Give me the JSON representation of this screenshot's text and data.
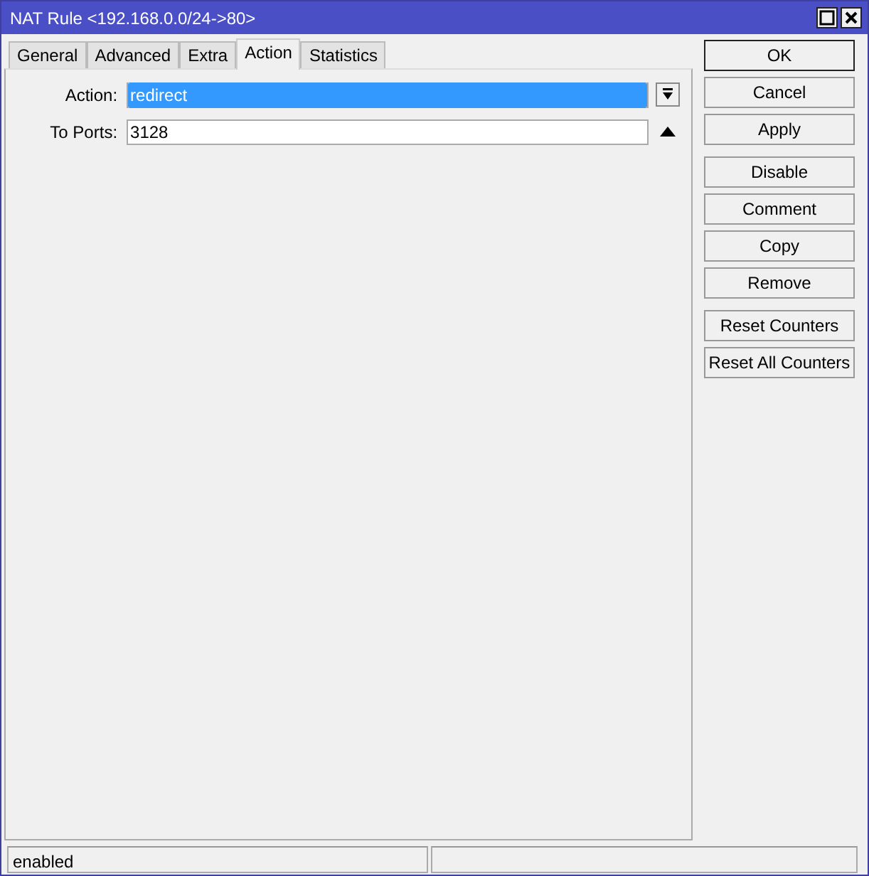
{
  "window": {
    "title": "NAT Rule <192.168.0.0/24->80>"
  },
  "tabs": [
    {
      "label": "General",
      "selected": false
    },
    {
      "label": "Advanced",
      "selected": false
    },
    {
      "label": "Extra",
      "selected": false
    },
    {
      "label": "Action",
      "selected": true
    },
    {
      "label": "Statistics",
      "selected": false
    }
  ],
  "fields": [
    {
      "label": "Action:",
      "value": "redirect",
      "kind": "dropdown",
      "highlighted": true
    },
    {
      "label": "To Ports:",
      "value": "3128",
      "kind": "spin",
      "highlighted": false
    }
  ],
  "button_groups": [
    [
      {
        "label": "OK",
        "default": true
      },
      {
        "label": "Cancel",
        "default": false
      },
      {
        "label": "Apply",
        "default": false
      }
    ],
    [
      {
        "label": "Disable",
        "default": false
      },
      {
        "label": "Comment",
        "default": false
      },
      {
        "label": "Copy",
        "default": false
      },
      {
        "label": "Remove",
        "default": false
      }
    ],
    [
      {
        "label": "Reset Counters",
        "default": false
      },
      {
        "label": "Reset All Counters",
        "default": false
      }
    ]
  ],
  "status_bar": {
    "text": "enabled"
  }
}
